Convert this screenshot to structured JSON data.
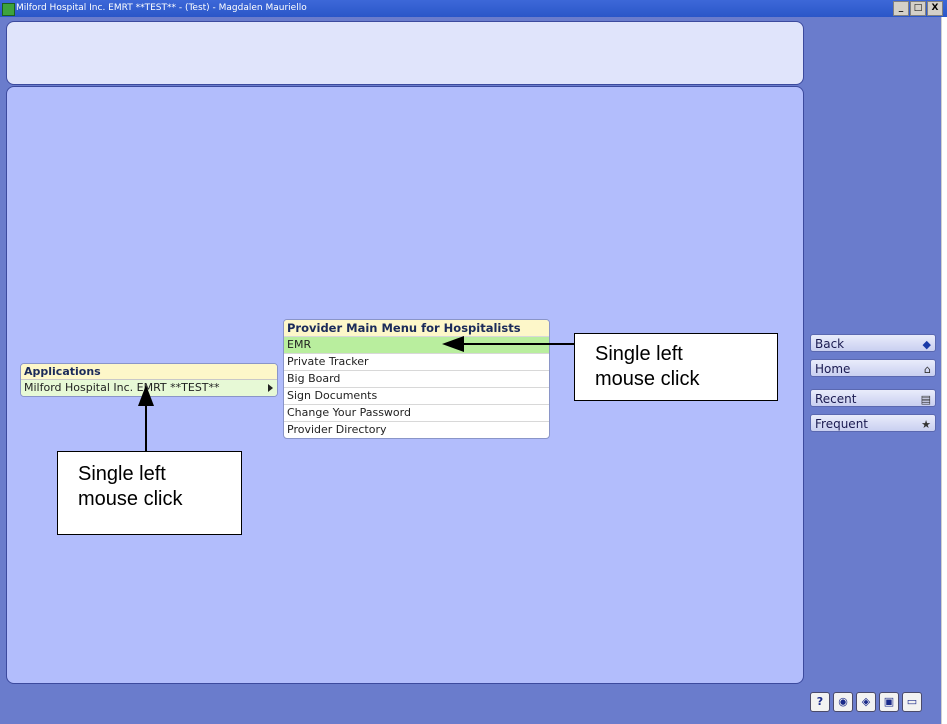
{
  "window": {
    "title": "Milford Hospital Inc. EMRT **TEST** - (Test) - Magdalen Mauriello",
    "controls": [
      "_",
      "□",
      "X"
    ]
  },
  "applications": {
    "header": "Applications",
    "item": "Milford Hospital Inc.  EMRT **TEST**"
  },
  "provider_menu": {
    "header": "Provider Main Menu for Hospitalists",
    "items": [
      "EMR",
      "Private Tracker",
      "Big Board",
      "Sign Documents",
      "Change Your Password",
      "Provider Directory"
    ],
    "selected": "EMR"
  },
  "callouts": {
    "right": "Single left\nmouse click",
    "left": "Single left\nmouse click"
  },
  "nav": {
    "back": "Back",
    "home": "Home",
    "recent": "Recent",
    "frequent": "Frequent",
    "icons": [
      "left-arrow-icon",
      "house-icon",
      "recent-docs-icon",
      "frequent-docs-icon"
    ]
  },
  "toolbar": {
    "help_label": "?",
    "icons": [
      "help-icon",
      "globe-icon",
      "settings-icon",
      "lock-icon",
      "exit-icon"
    ]
  },
  "colors": {
    "frame": "#6a7ccc",
    "main_panel": "#b2bdfc",
    "top_panel": "#e0e4fb",
    "menu_header": "#fdf7c9",
    "selected_item": "#b9ee9e",
    "app_item": "#e7f9d6"
  }
}
